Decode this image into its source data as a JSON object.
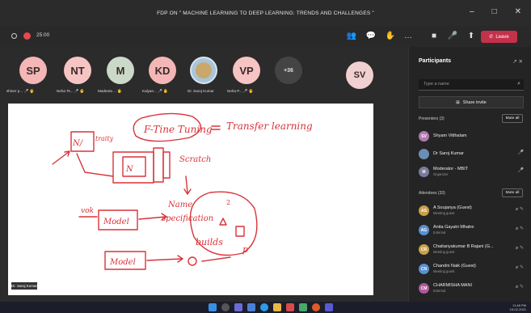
{
  "window": {
    "title": "FDP ON \" MACHINE LEARNING TO DEEP LEARNING: TRENDS AND CHALLENGES \"",
    "min": "–",
    "max": "□",
    "close": "✕"
  },
  "toolbar": {
    "timer": "25:00",
    "leave": "Leave"
  },
  "participants_strip": [
    {
      "initials": "SP",
      "color": "#f4b6b6",
      "label": "shiner p... 🎤 🖐"
    },
    {
      "initials": "NT",
      "color": "#f7c4c4",
      "label": "Neha Ts... 🎤 🖐"
    },
    {
      "initials": "M",
      "color": "#cbd9c8",
      "label": "Madeeta ... 🖐"
    },
    {
      "initials": "KD",
      "color": "#f4b6b6",
      "label": "Kalyan... 🎤 🖐"
    },
    {
      "initials": "",
      "color": "#a9c4dc",
      "label": "Dr. Saroj Kumar"
    },
    {
      "initials": "VP",
      "color": "#f7c4c4",
      "label": "Neha P... 🎤 🖐"
    },
    {
      "initials": "+36",
      "color": "#444444",
      "label": ""
    },
    {
      "initials": "SV",
      "color": "#f0d0d0",
      "label": ""
    }
  ],
  "panel": {
    "title": "Participants",
    "search_placeholder": "Type a name",
    "share_label": "Share invite",
    "presenters_label": "Presenters (3)",
    "attendees_label": "Attendees (33)",
    "mute_all": "Mute all",
    "presenters": [
      {
        "initials": "SV",
        "color": "#b07ab0",
        "name": "Shyam Vitthalam",
        "sub": ""
      },
      {
        "initials": "",
        "color": "#6a8fb5",
        "name": "Dr Saroj Kumar",
        "sub": ""
      },
      {
        "initials": "M",
        "color": "#7a7a9a",
        "name": "Moderator - MBIT",
        "sub": "Organizer"
      }
    ],
    "attendees": [
      {
        "initials": "AS",
        "color": "#c9a04a",
        "name": "A Soujanya (Guest)",
        "sub": "Meeting guest"
      },
      {
        "initials": "AG",
        "color": "#5a8fd0",
        "name": "Anita Gayatri Mhatre",
        "sub": "External"
      },
      {
        "initials": "CR",
        "color": "#c9a04a",
        "name": "Chaitanyakumar B Rajani (G...",
        "sub": "Meeting guest"
      },
      {
        "initials": "CN",
        "color": "#5a8fd0",
        "name": "Chandni Naik (Guest)",
        "sub": "Meeting guest"
      },
      {
        "initials": "CM",
        "color": "#b05a9a",
        "name": "CHARMISHA MANI",
        "sub": "External"
      }
    ]
  },
  "stage": {
    "presenter_tag": "Dr. Saroj Kumar"
  },
  "tray": {
    "time": "11:48 PM",
    "date": "15-02-2021"
  },
  "colors": {
    "accent_leave": "#c4314b",
    "ink": "#d8333a"
  }
}
